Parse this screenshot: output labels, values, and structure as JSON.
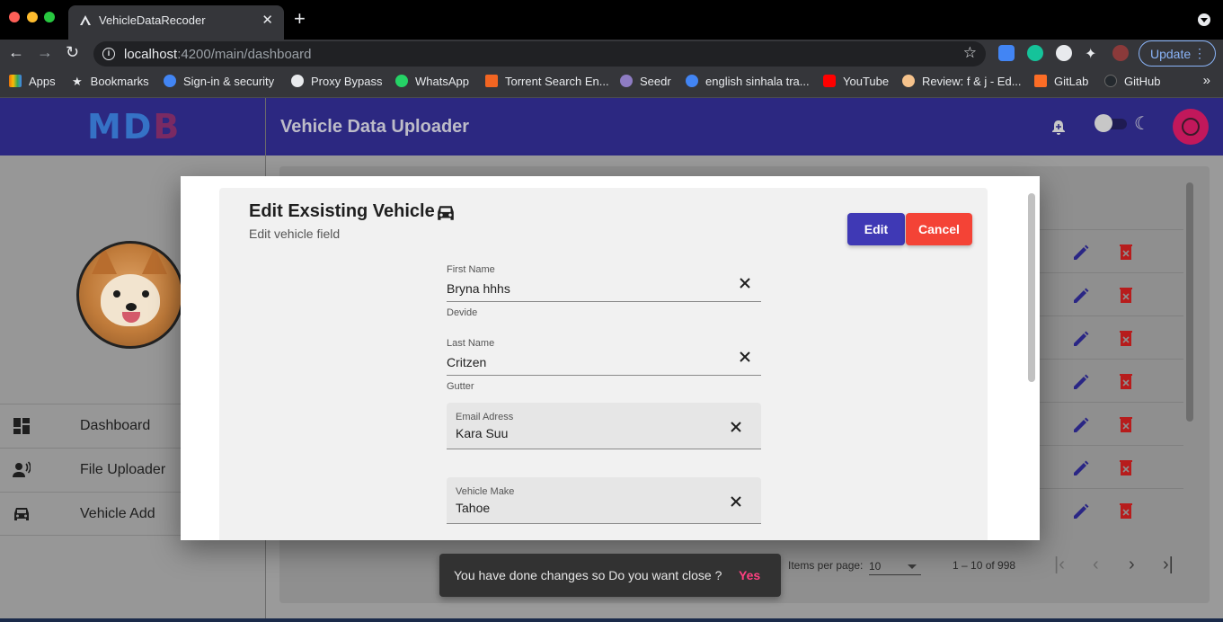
{
  "browser": {
    "tab_title": "VehicleDataRecoder",
    "url_host": "localhost",
    "url_path": ":4200/main/dashboard",
    "update_label": "Update",
    "bookmarks": [
      {
        "label": "Apps",
        "icon": "apps-grid-icon",
        "color": "#e8710a"
      },
      {
        "label": "Bookmarks",
        "icon": "star-icon",
        "color": "#e8eaed"
      },
      {
        "label": "Sign-in & security",
        "icon": "google-icon",
        "color": "#4285f4"
      },
      {
        "label": "Proxy Bypass",
        "icon": "proxy-icon",
        "color": "#e8eaed"
      },
      {
        "label": "WhatsApp",
        "icon": "whatsapp-icon",
        "color": "#25d366"
      },
      {
        "label": "Torrent Search En...",
        "icon": "torrent-icon",
        "color": "#f26522"
      },
      {
        "label": "Seedr",
        "icon": "seedr-icon",
        "color": "#8e7cc3"
      },
      {
        "label": "english sinhala tra...",
        "icon": "google-icon",
        "color": "#4285f4"
      },
      {
        "label": "YouTube",
        "icon": "youtube-icon",
        "color": "#ff0000"
      },
      {
        "label": "Review: f & j - Ed...",
        "icon": "review-icon",
        "color": "#f5c28c"
      },
      {
        "label": "GitLab",
        "icon": "gitlab-icon",
        "color": "#fc6d26"
      },
      {
        "label": "GitHub",
        "icon": "github-icon",
        "color": "#24292e"
      }
    ]
  },
  "app": {
    "logo_main": "MD",
    "logo_accent": "B",
    "title": "Vehicle Data Uploader",
    "brand_color": "#2c2881",
    "nav": [
      {
        "label": "Dashboard",
        "icon": "dashboard-icon"
      },
      {
        "label": "File Uploader",
        "icon": "record-voice-icon"
      },
      {
        "label": "Vehicle Add",
        "icon": "car-icon"
      }
    ]
  },
  "paginator": {
    "items_per_page_label": "Items per page:",
    "items_per_page_value": "10",
    "range_label": "1 – 10 of 998"
  },
  "dialog": {
    "title": "Edit Exsisting Vehicle",
    "subtitle": "Edit vehicle field",
    "edit_label": "Edit",
    "cancel_label": "Cancel",
    "fields": {
      "first_name": {
        "label": "First Name",
        "value": "Bryna hhhs",
        "hint": "Devide"
      },
      "last_name": {
        "label": "Last Name",
        "value": "Critzen",
        "hint": "Gutter"
      },
      "email": {
        "label": "Email Adress",
        "value": "Kara Suu"
      },
      "vehicle_make": {
        "label": "Vehicle Make",
        "value": "Tahoe"
      }
    }
  },
  "snackbar": {
    "message": "You have done changes so Do you want close ?",
    "action": "Yes"
  }
}
